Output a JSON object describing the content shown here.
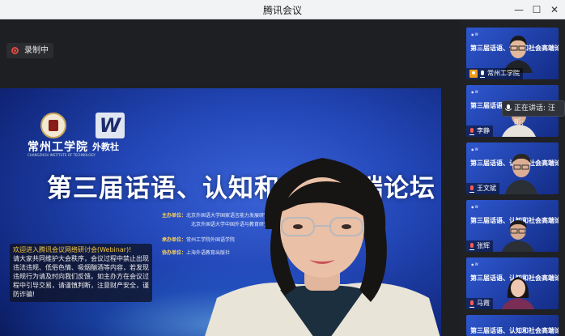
{
  "app": {
    "title": "腾讯会议"
  },
  "window_controls": {
    "minimize": "—",
    "maximize": "☐",
    "close": "✕"
  },
  "recording": {
    "label": "录制中"
  },
  "slide": {
    "logo1_text": "常州工学院",
    "logo1_sub": "CHANGZHOU INSTITUTE OF TECHNOLOGY",
    "logo2_mark": "W",
    "logo2_text": "外教社",
    "title": "第三届话语、认知和社会高端论坛",
    "organizers": [
      {
        "role": "主办单位：",
        "name": "北京外国语大学国家语言能力发展研究中心"
      },
      {
        "role": "",
        "name": "北京外国语大学中国外语与教育研究中心"
      },
      {
        "role": "承办单位：",
        "name": "常州工学院外国语学院"
      },
      {
        "role": "协办单位：",
        "name": "上海外语教育出版社"
      }
    ]
  },
  "notice": {
    "header": "欢迎进入腾讯会议网络研讨会(Webinar)!",
    "body": "请大家共同维护大会秩序，会议过程中禁止出现违法违规、低俗色情、吸烟酗酒等内容，若发现违规行为请及时向我们反馈。如主办方在会议过程中引导交易，请谨慎判断，注意财产安全，谨防诈骗!"
  },
  "speaking_tip": {
    "label": "正在讲话: 汪昕;"
  },
  "participants": [
    {
      "name": "常州工学院",
      "thumb_title": "第三届话语、认知和社会高端论坛",
      "mic": "on",
      "host": true
    },
    {
      "name": "李静",
      "thumb_title": "第三届话语、认知和社会高端论坛",
      "mic": "off",
      "host": false
    },
    {
      "name": "王文斌",
      "thumb_title": "第三届话语、认知和社会高端论坛",
      "mic": "off",
      "host": false
    },
    {
      "name": "张辉",
      "thumb_title": "第三届话语、认知和社会高端论坛",
      "mic": "off",
      "host": false
    },
    {
      "name": "马霞",
      "thumb_title": "第三届话语、认知和社会高端论坛",
      "mic": "off",
      "host": false
    },
    {
      "name": "",
      "thumb_title": "第三届话语、认知和社会高端论坛",
      "mic": "off",
      "host": false
    }
  ],
  "colors": {
    "accent_rec": "#e0483e",
    "slide_blue": "#2246b6",
    "notice_header": "#f5c842",
    "org_label": "#ffd35a"
  }
}
